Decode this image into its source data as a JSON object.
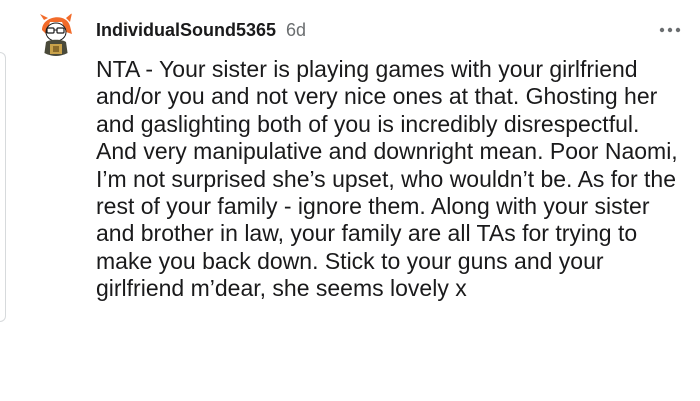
{
  "comment": {
    "author": "IndividualSound5365",
    "age": "6d",
    "avatar_icon": "reddit-snoo-avatar-icon",
    "menu_icon": "more-options-icon",
    "body": "NTA - Your sister is playing games with your girlfriend and/or you and not very nice ones at that. Ghosting her and gaslighting both of you is incredibly disrespectful. And very manipulative and downright mean. Poor Naomi, I’m not surprised she’s upset, who wouldn’t be. As for the rest of your family - ignore them. Along with your sister and brother in law, your family are all TAs for trying to make you back down. Stick to your guns and your girlfriend m’dear, she seems lovely x"
  },
  "colors": {
    "text": "#1a1a1b",
    "meta": "#6b6e70",
    "thread_line": "#d7dadc",
    "avatar_accent": "#f26b2a"
  }
}
